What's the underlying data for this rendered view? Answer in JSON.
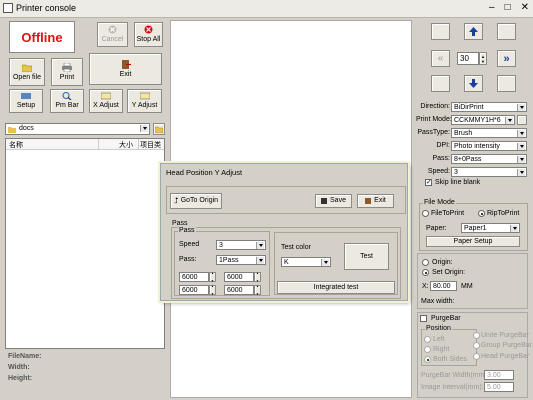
{
  "window": {
    "title": "Printer console"
  },
  "status": {
    "text": "Offline",
    "color": "#e01010"
  },
  "toolbar": {
    "cancel_label": "Cancel",
    "stop_all_label": "Stop All",
    "open_file_label": "Open file",
    "print_label": "Print",
    "exit_label": "Exit",
    "setup_label": "Setup",
    "pm_bar_label": "Pm Bar",
    "x_adjust_label": "X Adjust",
    "y_adjust_label": "Y Adjust"
  },
  "file_panel": {
    "folder": "docs",
    "col_name": "名称",
    "col_size": "大小",
    "col_type": "项目类",
    "info_filename": "FileName:",
    "info_width": "Width:",
    "info_height": "Height:"
  },
  "nav": {
    "step_value": "30"
  },
  "settings": {
    "direction_label": "Direction:",
    "direction_value": "BiDirPrint",
    "print_mode_label": "Print Mode:",
    "print_mode_value": "CCKMMY1H*6",
    "pass_type_label": "PassType:",
    "pass_type_value": "Brush",
    "dpi_label": "DPI:",
    "dpi_value": "Photo intensity",
    "pass_label": "Pass:",
    "pass_value": "8+0Pass",
    "speed_label": "Speed:",
    "speed_value": "3",
    "skip_line_label": "Skip line blank"
  },
  "file_mode": {
    "title": "File Mode",
    "file_to_print": "FileToPrint",
    "rip_to_print": "RipToPrint",
    "paper_label": "Paper:",
    "paper_value": "Paper1",
    "paper_setup_label": "Paper Setup"
  },
  "origin": {
    "origin_label": "Origin:",
    "set_origin_label": "Set Origin:",
    "x_label": "X:",
    "x_value": "80.00",
    "unit": "MM",
    "max_width_label": "Max width:"
  },
  "purge": {
    "purge_bar_label": "PurgeBar",
    "position_title": "Position",
    "left": "Left",
    "right": "Right",
    "both_sides": "Both Sides",
    "unite": "Unite PurgeBar",
    "group": "Group PurgeBar",
    "head": "Head PurgeBar",
    "width_label": "PurgeBar Width(mm):",
    "width_value": "3.00",
    "interval_label": "Image Interval(mm):",
    "interval_value": "5.00"
  },
  "dialog": {
    "title": "Head Position Y Adjust",
    "goto_origin": "GoTo Origin",
    "save": "Save",
    "exit": "Exit",
    "pass_group": "Pass",
    "pass_inner": "Pass",
    "speed_label": "Speed",
    "speed_value": "3",
    "pass_label": "Pass:",
    "pass_value": "1Pass",
    "v1": "6000",
    "v2": "6000",
    "v3": "6000",
    "v4": "6000",
    "test_color_label": "Test color",
    "test_color_value": "K",
    "test_label": "Test",
    "integrated_test_label": "Integrated test"
  }
}
